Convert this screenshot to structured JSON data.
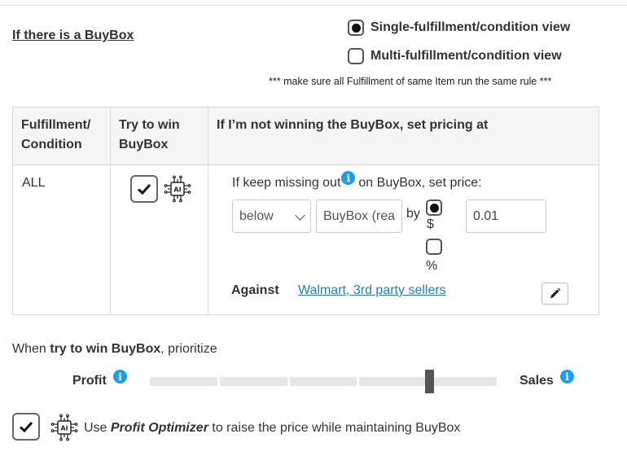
{
  "header": {
    "title": "If there is a BuyBox",
    "view_options": [
      {
        "label": "Single-fulfillment/condition view",
        "selected": true
      },
      {
        "label": "Multi-fulfillment/condition view",
        "selected": false
      }
    ],
    "note": "*** make sure all Fulfillment of same Item run the same rule ***"
  },
  "table": {
    "headers": [
      "Fulfillment/ Condition",
      "Try to win BuyBox",
      "If I’m not winning the BuyBox, set pricing at"
    ],
    "row": {
      "fulfillment": "ALL",
      "try_to_win_checked": true,
      "ai_icon": "ai-chip-icon",
      "missing_prefix": "If keep missing out",
      "missing_suffix": "on BuyBox, set price:",
      "direction_value": "below",
      "reference_value": "BuyBox (rea",
      "by_label": "by",
      "unit_dollar_label": "$",
      "unit_dollar_selected": true,
      "unit_percent_label": "%",
      "unit_percent_selected": false,
      "amount_value": "0.01",
      "against_label": "Against",
      "against_link": "Walmart, 3rd party sellers"
    }
  },
  "priority": {
    "prefix": "When ",
    "bold": "try to win BuyBox",
    "suffix": ", prioritize",
    "left_label": "Profit",
    "right_label": "Sales",
    "slider_level": 0.85
  },
  "optimizer": {
    "checked": true,
    "text_before": "Use ",
    "text_bold": "Profit Optimizer",
    "text_after": " to raise the price while maintaining BuyBox"
  },
  "colors": {
    "link": "#2a7ab8",
    "info_icon": "#1e9ee8",
    "slider_handle": "#555555",
    "slider_track": "#e6e6e6"
  }
}
